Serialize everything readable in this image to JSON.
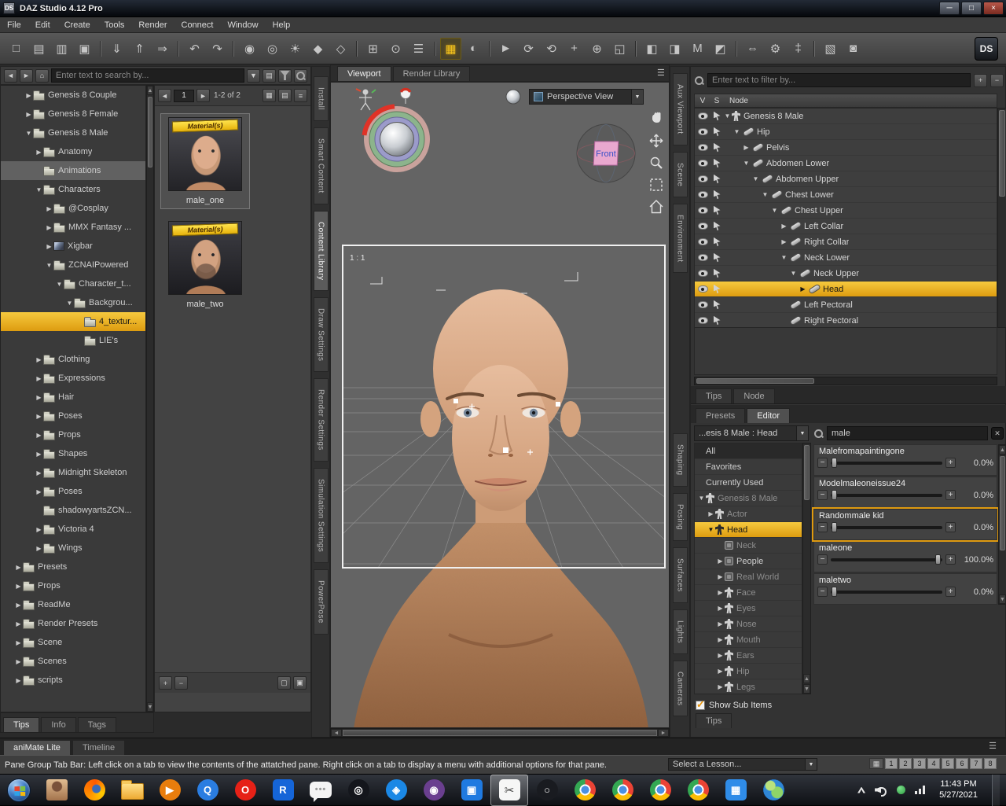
{
  "window": {
    "app_initials": "DS",
    "title": "DAZ Studio 4.12 Pro"
  },
  "menu": {
    "items": [
      {
        "label": "File"
      },
      {
        "label": "Edit"
      },
      {
        "label": "Create"
      },
      {
        "label": "Tools"
      },
      {
        "label": "Render"
      },
      {
        "label": "Connect"
      },
      {
        "label": "Window"
      },
      {
        "label": "Help"
      }
    ]
  },
  "toolbar": {
    "icons": [
      {
        "name": "new-file-icon",
        "glyph": "□"
      },
      {
        "name": "open-file-icon",
        "glyph": "▤"
      },
      {
        "name": "open-recent-icon",
        "glyph": "▥"
      },
      {
        "name": "save-file-icon",
        "glyph": "▣"
      },
      {
        "name": "import-icon",
        "glyph": "⇓",
        "gap": "true"
      },
      {
        "name": "export-icon",
        "glyph": "⇑"
      },
      {
        "name": "send-to-icon",
        "glyph": "⇒"
      },
      {
        "name": "undo-icon",
        "glyph": "↶",
        "gap": "true"
      },
      {
        "name": "redo-icon",
        "glyph": "↷"
      },
      {
        "name": "create-camera-icon",
        "glyph": "◉",
        "gap": "true"
      },
      {
        "name": "create-spotlight-icon",
        "glyph": "◎"
      },
      {
        "name": "create-point-light-icon",
        "glyph": "☀"
      },
      {
        "name": "create-primitive-icon",
        "glyph": "◆"
      },
      {
        "name": "create-null-icon",
        "glyph": "◇"
      },
      {
        "name": "frame-icon",
        "glyph": "⊞",
        "gap": "true"
      },
      {
        "name": "aim-icon",
        "glyph": "⊙"
      },
      {
        "name": "align-icon",
        "glyph": "☰"
      },
      {
        "name": "texture-atlas-icon",
        "glyph": "▦",
        "gap": "true",
        "hl": "gold"
      },
      {
        "name": "iray-preview-icon",
        "glyph": "◐"
      },
      {
        "name": "node-selection-icon",
        "glyph": "►",
        "gap": "true"
      },
      {
        "name": "rotate-tool-icon",
        "glyph": "⟳"
      },
      {
        "name": "twist-tool-icon",
        "glyph": "⟲"
      },
      {
        "name": "translate-tool-icon",
        "glyph": "+"
      },
      {
        "name": "universal-tool-icon",
        "glyph": "⊕"
      },
      {
        "name": "scale-tool-icon",
        "glyph": "◱"
      },
      {
        "name": "surface-selection-icon",
        "glyph": "◧",
        "gap": "true"
      },
      {
        "name": "weight-map-icon",
        "glyph": "◨"
      },
      {
        "name": "measure-icon",
        "glyph": "M"
      },
      {
        "name": "geometry-editor-icon",
        "glyph": "◩"
      },
      {
        "name": "transfer-utility-icon",
        "glyph": "⇔",
        "gap": "true"
      },
      {
        "name": "figure-setup-icon",
        "glyph": "⚙"
      },
      {
        "name": "joint-editor-icon",
        "glyph": "‡"
      },
      {
        "name": "spot-render-icon",
        "glyph": "▧",
        "gap": "true"
      },
      {
        "name": "render-icon",
        "glyph": "◙"
      }
    ]
  },
  "content_library": {
    "search_placeholder": "Enter text to search by...",
    "tree": [
      {
        "label": "Genesis 8 Couple",
        "depth": 2,
        "arrow": "right",
        "icon": "folder"
      },
      {
        "label": "Genesis 8 Female",
        "depth": 2,
        "arrow": "right",
        "icon": "folder"
      },
      {
        "label": "Genesis 8 Male",
        "depth": 2,
        "arrow": "down",
        "icon": "folder"
      },
      {
        "label": "Anatomy",
        "depth": 3,
        "arrow": "right",
        "icon": "folder"
      },
      {
        "label": "Animations",
        "depth": 3,
        "arrow": "none",
        "icon": "folder",
        "sel": "gray"
      },
      {
        "label": "Characters",
        "depth": 3,
        "arrow": "down",
        "icon": "folder"
      },
      {
        "label": "@Cosplay",
        "depth": 4,
        "arrow": "right",
        "icon": "folder"
      },
      {
        "label": "MMX Fantasy ...",
        "depth": 4,
        "arrow": "right",
        "icon": "folder"
      },
      {
        "label": "Xigbar",
        "depth": 4,
        "arrow": "right",
        "icon": "photo"
      },
      {
        "label": "ZCNAIPowered",
        "depth": 4,
        "arrow": "down",
        "icon": "folder"
      },
      {
        "label": "Character_t...",
        "depth": 5,
        "arrow": "down",
        "icon": "folder"
      },
      {
        "label": "Backgrou...",
        "depth": 6,
        "arrow": "down",
        "icon": "folder"
      },
      {
        "label": "4_textur...",
        "depth": 7,
        "arrow": "none",
        "icon": "folder",
        "sel": "yellow"
      },
      {
        "label": "LIE's",
        "depth": 7,
        "arrow": "none",
        "icon": "folder"
      },
      {
        "label": "Clothing",
        "depth": 3,
        "arrow": "right",
        "icon": "folder"
      },
      {
        "label": "Expressions",
        "depth": 3,
        "arrow": "right",
        "icon": "folder"
      },
      {
        "label": "Hair",
        "depth": 3,
        "arrow": "right",
        "icon": "folder"
      },
      {
        "label": "Poses",
        "depth": 3,
        "arrow": "right",
        "icon": "folder"
      },
      {
        "label": "Props",
        "depth": 3,
        "arrow": "right",
        "icon": "folder"
      },
      {
        "label": "Shapes",
        "depth": 3,
        "arrow": "right",
        "icon": "folder"
      },
      {
        "label": "Midnight Skeleton",
        "depth": 3,
        "arrow": "right",
        "icon": "folder"
      },
      {
        "label": "Poses",
        "depth": 3,
        "arrow": "right",
        "icon": "folder"
      },
      {
        "label": "shadowyartsZCN...",
        "depth": 3,
        "arrow": "none",
        "icon": "folder"
      },
      {
        "label": "Victoria 4",
        "depth": 3,
        "arrow": "right",
        "icon": "folder"
      },
      {
        "label": "Wings",
        "depth": 3,
        "arrow": "right",
        "icon": "folder"
      },
      {
        "label": "Presets",
        "depth": 1,
        "arrow": "right",
        "icon": "folder"
      },
      {
        "label": "Props",
        "depth": 1,
        "arrow": "right",
        "icon": "folder"
      },
      {
        "label": "ReadMe",
        "depth": 1,
        "arrow": "right",
        "icon": "folder"
      },
      {
        "label": "Render Presets",
        "depth": 1,
        "arrow": "right",
        "icon": "folder"
      },
      {
        "label": "Scene",
        "depth": 1,
        "arrow": "right",
        "icon": "folder"
      },
      {
        "label": "Scenes",
        "depth": 1,
        "arrow": "right",
        "icon": "folder"
      },
      {
        "label": "scripts",
        "depth": 1,
        "arrow": "right",
        "icon": "folder"
      }
    ],
    "bottom_tabs": [
      {
        "label": "Tips",
        "active": "true"
      },
      {
        "label": "Info"
      },
      {
        "label": "Tags"
      }
    ]
  },
  "asset_browser": {
    "page": "1",
    "range_label": "1-2 of 2",
    "thumbnails": [
      {
        "name": "male_one",
        "badge": "Material(s)",
        "face": "face-one",
        "sel": "true"
      },
      {
        "name": "male_two",
        "badge": "Material(s)",
        "face": "face-two"
      }
    ]
  },
  "left_tabs": [
    {
      "name": "tab-install",
      "label": "Install"
    },
    {
      "name": "tab-smart-content",
      "label": "Smart Content"
    },
    {
      "name": "tab-content-library",
      "label": "Content Library",
      "active": "true"
    },
    {
      "name": "tab-draw-settings",
      "label": "Draw Settings"
    },
    {
      "name": "tab-render-settings",
      "label": "Render Settings"
    },
    {
      "name": "tab-simulation-settings",
      "label": "Simulation Settings"
    },
    {
      "name": "tab-powerpose",
      "label": "PowerPose"
    }
  ],
  "viewport": {
    "tabs": [
      {
        "name": "tab-viewport",
        "label": "Viewport",
        "active": "true"
      },
      {
        "name": "tab-render-library",
        "label": "Render Library"
      }
    ],
    "camera_selector": "Perspective View",
    "aspect_label": "1 : 1",
    "view_cube_label": "Front"
  },
  "right_tabs_top": [
    {
      "name": "tab-aux-viewport",
      "label": "Aux Viewport"
    },
    {
      "name": "tab-scene",
      "label": "Scene"
    },
    {
      "name": "tab-environment",
      "label": "Environment"
    }
  ],
  "right_tabs_bottom": [
    {
      "name": "tab-shaping",
      "label": "Shaping"
    },
    {
      "name": "tab-posing",
      "label": "Posing"
    },
    {
      "name": "tab-surfaces",
      "label": "Surfaces"
    },
    {
      "name": "tab-lights",
      "label": "Lights"
    },
    {
      "name": "tab-cameras",
      "label": "Cameras"
    }
  ],
  "scene_pane": {
    "filter_placeholder": "Enter text to filter by...",
    "columns": {
      "v": "V",
      "s": "S",
      "node": "Node"
    },
    "nodes": [
      {
        "label": "Genesis 8 Male",
        "depth": 0,
        "arrow": "down",
        "icon": "figure"
      },
      {
        "label": "Hip",
        "depth": 1,
        "arrow": "down",
        "icon": "bone"
      },
      {
        "label": "Pelvis",
        "depth": 2,
        "arrow": "right",
        "icon": "bone"
      },
      {
        "label": "Abdomen Lower",
        "depth": 2,
        "arrow": "down",
        "icon": "bone"
      },
      {
        "label": "Abdomen Upper",
        "depth": 3,
        "arrow": "down",
        "icon": "bone"
      },
      {
        "label": "Chest Lower",
        "depth": 4,
        "arrow": "down",
        "icon": "bone"
      },
      {
        "label": "Chest Upper",
        "depth": 5,
        "arrow": "down",
        "icon": "bone"
      },
      {
        "label": "Left Collar",
        "depth": 6,
        "arrow": "right",
        "icon": "bone"
      },
      {
        "label": "Right Collar",
        "depth": 6,
        "arrow": "right",
        "icon": "bone"
      },
      {
        "label": "Neck Lower",
        "depth": 6,
        "arrow": "down",
        "icon": "bone"
      },
      {
        "label": "Neck Upper",
        "depth": 7,
        "arrow": "down",
        "icon": "bone"
      },
      {
        "label": "Head",
        "depth": 8,
        "arrow": "right",
        "icon": "bone",
        "sel": "yellow"
      },
      {
        "label": "Left Pectoral",
        "depth": 6,
        "arrow": "none",
        "icon": "bone"
      },
      {
        "label": "Right Pectoral",
        "depth": 6,
        "arrow": "none",
        "icon": "bone"
      }
    ],
    "bottom_tabs": [
      {
        "label": "Tips"
      },
      {
        "label": "Node"
      }
    ]
  },
  "params_pane": {
    "tabs": [
      {
        "label": "Presets"
      },
      {
        "label": "Editor",
        "active": "true"
      }
    ],
    "scope_selector": "...esis 8 Male : Head",
    "search_value": "male",
    "categories": [
      {
        "label": "All",
        "depth": 0,
        "arrow": "none",
        "icon": "none",
        "variant": "dark"
      },
      {
        "label": "Favorites",
        "depth": 0,
        "arrow": "none",
        "icon": "none"
      },
      {
        "label": "Currently Used",
        "depth": 0,
        "arrow": "none",
        "icon": "none"
      },
      {
        "label": "Genesis 8 Male",
        "depth": 0,
        "arrow": "down",
        "icon": "figure",
        "dim": "true"
      },
      {
        "label": "Actor",
        "depth": 1,
        "arrow": "right",
        "icon": "figure",
        "dim": "true"
      },
      {
        "label": "Head",
        "depth": 1,
        "arrow": "down",
        "icon": "figure",
        "sel": "yellow"
      },
      {
        "label": "Neck",
        "depth": 2,
        "arrow": "none",
        "icon": "group",
        "dim": "true"
      },
      {
        "label": "People",
        "depth": 2,
        "arrow": "right",
        "icon": "group"
      },
      {
        "label": "Real World",
        "depth": 2,
        "arrow": "right",
        "icon": "group",
        "dim": "true"
      },
      {
        "label": "Face",
        "depth": 2,
        "arrow": "right",
        "icon": "figure",
        "dim": "true"
      },
      {
        "label": "Eyes",
        "depth": 2,
        "arrow": "right",
        "icon": "figure",
        "dim": "true"
      },
      {
        "label": "Nose",
        "depth": 2,
        "arrow": "right",
        "icon": "figure",
        "dim": "true"
      },
      {
        "label": "Mouth",
        "depth": 2,
        "arrow": "right",
        "icon": "figure",
        "dim": "true"
      },
      {
        "label": "Ears",
        "depth": 2,
        "arrow": "right",
        "icon": "figure",
        "dim": "true"
      },
      {
        "label": "Hip",
        "depth": 2,
        "arrow": "right",
        "icon": "figure",
        "dim": "true"
      },
      {
        "label": "Legs",
        "depth": 2,
        "arrow": "right",
        "icon": "figure",
        "dim": "true"
      }
    ],
    "show_sub_items_label": "Show Sub Items",
    "sliders": [
      {
        "name": "Malefromapaintingone",
        "value": "0.0%",
        "percent": 0
      },
      {
        "name": "Modelmaleoneissue24",
        "value": "0.0%",
        "percent": 0
      },
      {
        "name": "Randommale kid",
        "value": "0.0%",
        "percent": 0,
        "hl": "true"
      },
      {
        "name": "maleone",
        "value": "100.0%",
        "percent": 100
      },
      {
        "name": "maletwo",
        "value": "0.0%",
        "percent": 0
      }
    ],
    "bottom_tab": "Tips"
  },
  "bottom_bar": {
    "tabs": [
      {
        "label": "aniMate Lite",
        "active": "true"
      },
      {
        "label": "Timeline"
      }
    ],
    "status_text": "Pane Group Tab Bar: Left click on a tab to view the contents of the attatched pane. Right click on a tab to display a menu with additional options for that pane.",
    "lesson_selector": "Select a Lesson...",
    "pager": [
      "1",
      "2",
      "3",
      "4",
      "5",
      "6",
      "7",
      "8"
    ]
  },
  "taskbar": {
    "items": [
      {
        "name": "taskbar-user-photo",
        "kind": "photo"
      },
      {
        "name": "taskbar-firefox",
        "kind": "firefox"
      },
      {
        "name": "taskbar-folder",
        "kind": "folder"
      },
      {
        "name": "taskbar-media-player",
        "kind": "glyph",
        "color": "#e87d0d",
        "glyph": "▶"
      },
      {
        "name": "taskbar-browser-q",
        "kind": "glyph",
        "color": "#2a7de1",
        "glyph": "Q"
      },
      {
        "name": "taskbar-opera",
        "kind": "glyph",
        "color": "#e62117",
        "glyph": "O"
      },
      {
        "name": "taskbar-remote",
        "kind": "glyph",
        "color": "#1565d8",
        "glyph": "R",
        "shape": "square"
      },
      {
        "name": "taskbar-messages",
        "kind": "chat"
      },
      {
        "name": "taskbar-obs",
        "kind": "glyph",
        "color": "#14161c",
        "glyph": "◎"
      },
      {
        "name": "taskbar-safari",
        "kind": "glyph",
        "color": "#1b88e5",
        "glyph": "◈"
      },
      {
        "name": "taskbar-tor",
        "kind": "glyph",
        "color": "#6a3f8f",
        "glyph": "◉"
      },
      {
        "name": "taskbar-photos",
        "kind": "glyph",
        "color": "#1f7ae0",
        "glyph": "▣",
        "shape": "square"
      },
      {
        "name": "taskbar-snipping",
        "kind": "scissors",
        "glyph": "✂",
        "active": "true"
      },
      {
        "name": "taskbar-steam",
        "kind": "glyph",
        "color": "#191b20",
        "glyph": "○"
      },
      {
        "name": "taskbar-chrome-1",
        "kind": "chrome"
      },
      {
        "name": "taskbar-chrome-2",
        "kind": "chrome"
      },
      {
        "name": "taskbar-chrome-3",
        "kind": "chrome"
      },
      {
        "name": "taskbar-chrome-4",
        "kind": "chrome"
      },
      {
        "name": "taskbar-photos-2",
        "kind": "glyph",
        "color": "#2f8ce8",
        "glyph": "▦",
        "shape": "square"
      },
      {
        "name": "taskbar-earth",
        "kind": "earth"
      }
    ],
    "tray": {
      "time": "11:43 PM",
      "date": "5/27/2021"
    }
  },
  "colors": {
    "selection_yellow": "#e9b11c",
    "selection_gray": "#5e5e5e",
    "badge_yellow": "#f0c419",
    "toolbar_highlight_gold": "#f5c51e"
  }
}
